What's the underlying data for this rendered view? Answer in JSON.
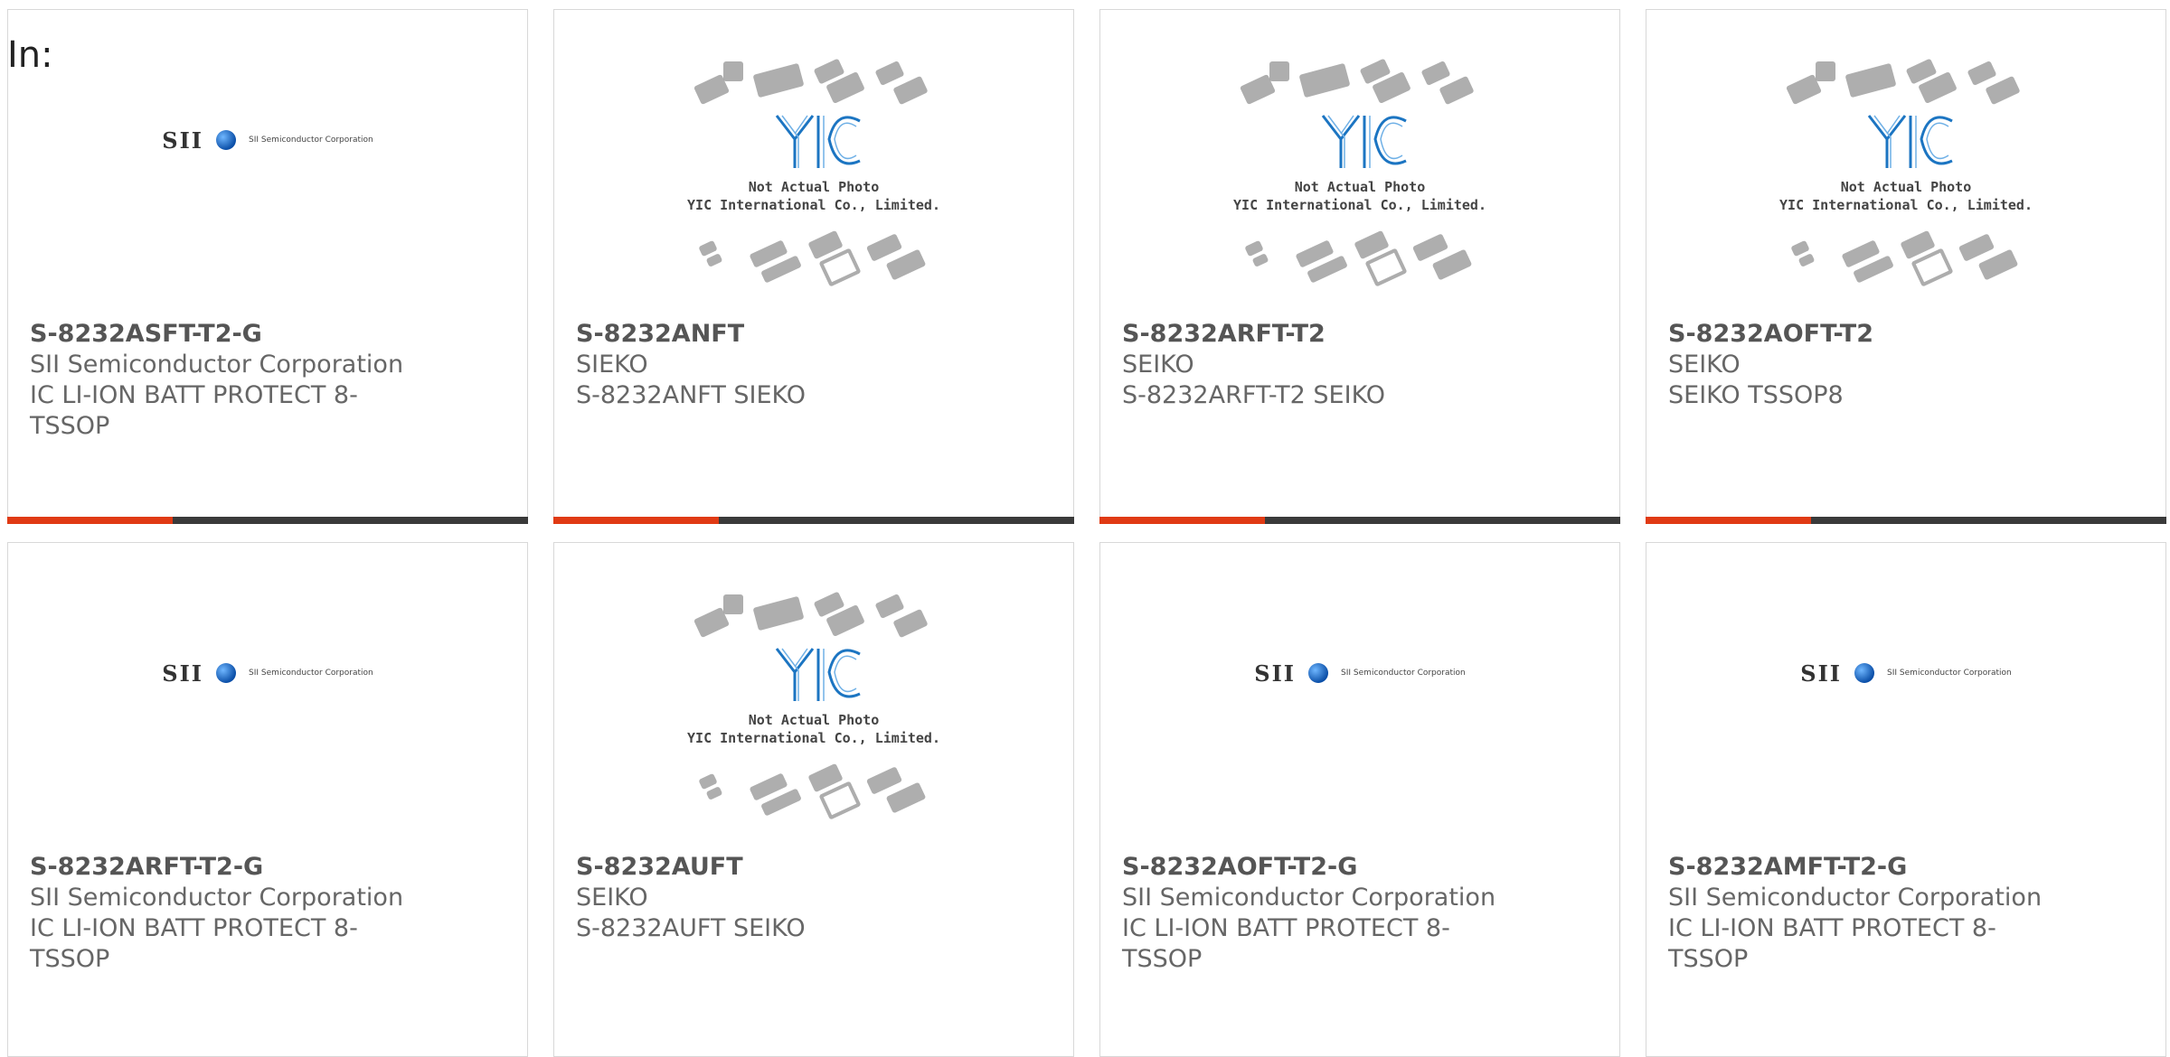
{
  "filter_label": "In:",
  "colors": {
    "accent": "#e03a14",
    "bar": "#3a3a3a",
    "border": "#d8d8d8"
  },
  "placeholder_logo": {
    "line1": "Not Actual Photo",
    "line2": "YIC International Co., Limited."
  },
  "sii_logo": {
    "mark": "SII",
    "subtitle": "SII Semiconductor Corporation"
  },
  "cards": [
    {
      "part_number": "S-8232ASFT-T2-G",
      "manufacturer": "SII Semiconductor Corporation",
      "description": "IC LI-ION BATT PROTECT 8-TSSOP",
      "image": "sii-logo",
      "show_bar": true
    },
    {
      "part_number": "S-8232ANFT",
      "manufacturer": "SIEKO",
      "description": "S-8232ANFT SIEKO",
      "image": "yic-placeholder",
      "show_bar": true
    },
    {
      "part_number": "S-8232ARFT-T2",
      "manufacturer": "SEIKO",
      "description": "S-8232ARFT-T2 SEIKO",
      "image": "yic-placeholder",
      "show_bar": true
    },
    {
      "part_number": "S-8232AOFT-T2",
      "manufacturer": "SEIKO",
      "description": "SEIKO TSSOP8",
      "image": "yic-placeholder",
      "show_bar": true
    },
    {
      "part_number": "S-8232ARFT-T2-G",
      "manufacturer": "SII Semiconductor Corporation",
      "description": "IC LI-ION BATT PROTECT 8-TSSOP",
      "image": "sii-logo",
      "show_bar": false
    },
    {
      "part_number": "S-8232AUFT",
      "manufacturer": "SEIKO",
      "description": "S-8232AUFT SEIKO",
      "image": "yic-placeholder",
      "show_bar": false
    },
    {
      "part_number": "S-8232AOFT-T2-G",
      "manufacturer": "SII Semiconductor Corporation",
      "description": "IC LI-ION BATT PROTECT 8-TSSOP",
      "image": "sii-logo",
      "show_bar": false
    },
    {
      "part_number": "S-8232AMFT-T2-G",
      "manufacturer": "SII Semiconductor Corporation",
      "description": "IC LI-ION BATT PROTECT 8-TSSOP",
      "image": "sii-logo",
      "show_bar": false
    }
  ]
}
